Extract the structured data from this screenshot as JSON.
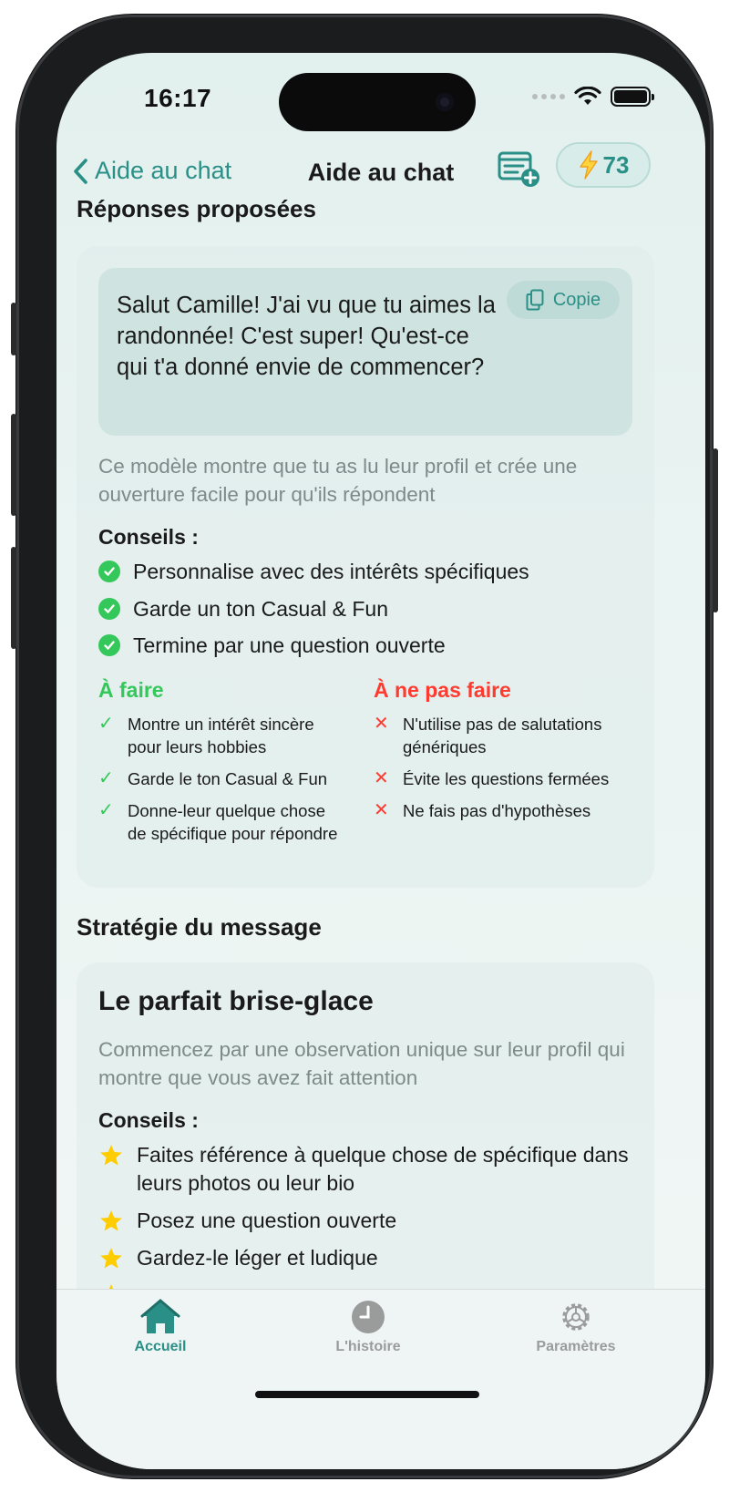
{
  "status_bar": {
    "time": "16:17"
  },
  "nav": {
    "back_label": "Aide au chat",
    "title": "Aide au chat",
    "credits": "73"
  },
  "suggested": {
    "section_title": "Réponses proposées",
    "message": "Salut Camille! J'ai vu que tu aimes la randonnée! C'est super! Qu'est-ce qui t'a donné envie de commencer?",
    "copy_label": "Copie",
    "explanation": "Ce modèle montre que tu as lu leur profil et crée une ouverture facile pour qu'ils répondent",
    "tips_label": "Conseils :",
    "tips": [
      "Personnalise avec des intérêts spécifiques",
      "Garde un ton Casual & Fun",
      "Termine par une question ouverte"
    ],
    "do_title": "À faire",
    "do_items": [
      "Montre un intérêt sincère pour leurs hobbies",
      "Garde le ton Casual & Fun",
      "Donne-leur quelque chose de spécifique pour répondre"
    ],
    "dont_title": "À ne pas faire",
    "dont_items": [
      "N'utilise pas de salutations génériques",
      "Évite les questions fermées",
      "Ne fais pas d'hypothèses"
    ]
  },
  "strategy": {
    "section_title": "Stratégie du message",
    "card_title": "Le parfait brise-glace",
    "description": "Commencez par une observation unique sur leur profil qui montre que vous avez fait attention",
    "tips_label": "Conseils :",
    "tips": [
      "Faites référence à quelque chose de spécifique dans leurs photos ou leur bio",
      "Posez une question ouverte",
      "Gardez-le léger et ludique"
    ]
  },
  "tabs": [
    {
      "label": "Accueil",
      "icon": "house-icon",
      "active": true
    },
    {
      "label": "L'histoire",
      "icon": "clock-icon",
      "active": false
    },
    {
      "label": "Paramètres",
      "icon": "gear-icon",
      "active": false
    }
  ],
  "colors": {
    "accent": "#2a8f86",
    "do_green": "#34c759",
    "dont_red": "#ff3b30",
    "star": "#ffcc00",
    "muted_text": "#7d8a8a"
  }
}
